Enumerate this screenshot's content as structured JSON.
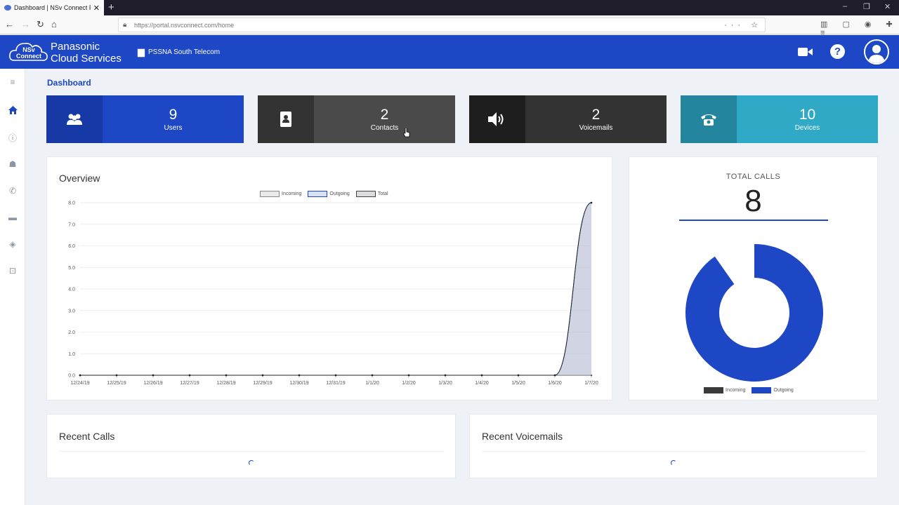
{
  "browser": {
    "tab_title": "Dashboard | NSv Connect Port",
    "url": "https://portal.nsvconnect.com/home"
  },
  "header": {
    "logo_text": "NSv Connect",
    "brand_line1": "Panasonic",
    "brand_line2": "Cloud Services",
    "tenant": "PSSNA South Telecom"
  },
  "breadcrumb": "Dashboard",
  "stats": [
    {
      "value": "9",
      "label": "Users",
      "icon": "users-icon",
      "color": "#1d47c4",
      "icon_bg": "#1739a5"
    },
    {
      "value": "2",
      "label": "Contacts",
      "icon": "contacts-book-icon",
      "color": "#4a4a4a",
      "icon_bg": "#333333"
    },
    {
      "value": "2",
      "label": "Voicemails",
      "icon": "speaker-icon",
      "color": "#333333",
      "icon_bg": "#1e1e1e"
    },
    {
      "value": "10",
      "label": "Devices",
      "icon": "telephone-icon",
      "color": "#2fa9c6",
      "icon_bg": "#23869e"
    }
  ],
  "overview": {
    "title": "Overview"
  },
  "chart_data": [
    {
      "type": "area",
      "legend": [
        "Incoming",
        "Outgoing",
        "Total"
      ],
      "legend_placement": "top-center",
      "categories": [
        "12/24/19",
        "12/25/19",
        "12/26/19",
        "12/27/19",
        "12/28/19",
        "12/29/19",
        "12/30/19",
        "12/31/19",
        "1/1/20",
        "1/2/20",
        "1/3/20",
        "1/4/20",
        "1/5/20",
        "1/6/20",
        "1/7/20"
      ],
      "yticks": [
        "0.0",
        "1.0",
        "2.0",
        "3.0",
        "4.0",
        "5.0",
        "6.0",
        "7.0",
        "8.0"
      ],
      "ylim": [
        0,
        8
      ],
      "series": [
        {
          "name": "Incoming",
          "values": [
            0,
            0,
            0,
            0,
            0,
            0,
            0,
            0,
            0,
            0,
            0,
            0,
            0,
            0,
            0
          ]
        },
        {
          "name": "Outgoing",
          "values": [
            0,
            0,
            0,
            0,
            0,
            0,
            0,
            0,
            0,
            0,
            0,
            0,
            0,
            0,
            8
          ]
        },
        {
          "name": "Total",
          "values": [
            0,
            0,
            0,
            0,
            0,
            0,
            0,
            0,
            0,
            0,
            0,
            0,
            0,
            0,
            8
          ]
        }
      ],
      "grid": true
    },
    {
      "type": "pie",
      "title": "TOTAL CALLS",
      "total": "8",
      "legend": [
        "Incoming",
        "Outgoing"
      ],
      "legend_placement": "bottom",
      "values": [
        0,
        8
      ],
      "colors": [
        "#3a3a3a",
        "#1d47c4"
      ]
    }
  ],
  "recent_calls": {
    "title": "Recent Calls"
  },
  "recent_voicemails": {
    "title": "Recent Voicemails"
  }
}
